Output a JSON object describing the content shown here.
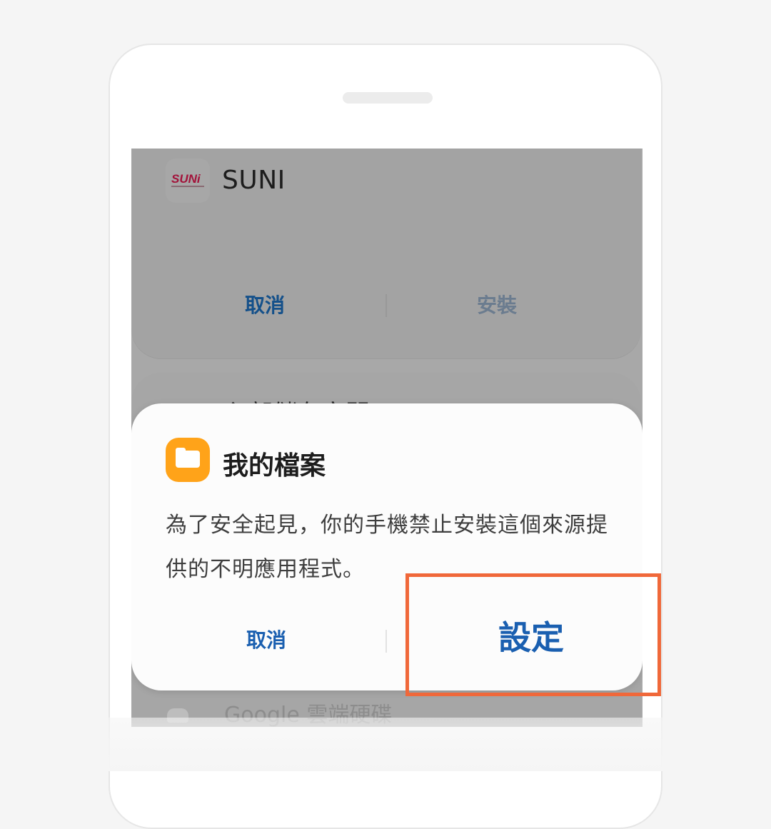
{
  "install_card": {
    "app_title": "SUNI",
    "cancel_label": "取消",
    "install_label": "安裝"
  },
  "source_card": {
    "title": "內部儲存空間",
    "google_drive": "Google 雲端硬碟"
  },
  "dialog": {
    "title": "我的檔案",
    "message": "為了安全起見，你的手機禁止安裝這個來源提供的不明應用程式。",
    "cancel_label": "取消",
    "settings_label": "設定"
  },
  "logo": {
    "text": "SUNi"
  },
  "colors": {
    "accent": "#1a5fb0",
    "highlight": "#f0683a",
    "files_icon": "#ffa319"
  },
  "icons": [
    "suni-app-icon",
    "my-files-folder-icon",
    "google-drive-icon"
  ]
}
